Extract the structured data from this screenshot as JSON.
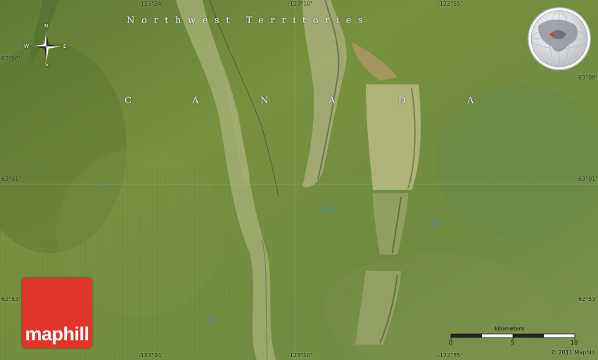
{
  "map": {
    "region_label": "Northwest Territories",
    "country_letters": [
      "C",
      "A",
      "N",
      "A",
      "D",
      "A"
    ],
    "colors": {
      "terrain": "#6f8a3e",
      "ridge": "#a7b27a",
      "water": "#5d8a86",
      "label": "#f4f1e6",
      "logo": "#e2352a"
    }
  },
  "coords": {
    "top": [
      "-123°24'",
      "-123°10'",
      "-122°55'"
    ],
    "bottom": [
      "-123°24'",
      "-123°10'",
      "-122°55'"
    ],
    "left": [
      "63°08'",
      "63°01'",
      "62°53'"
    ],
    "right": [
      "63°08'",
      "63°01'",
      "62°53'"
    ]
  },
  "compass": {
    "icon": "compass-rose-icon",
    "n": "N",
    "s": "S",
    "e": "E",
    "w": "W"
  },
  "globe": {
    "icon": "globe-locator-icon"
  },
  "logo": {
    "text": "maphill"
  },
  "scale": {
    "unit": "kilometers",
    "ticks": [
      "0",
      "5",
      "10"
    ]
  },
  "copyright": "© 2011 Maphill"
}
